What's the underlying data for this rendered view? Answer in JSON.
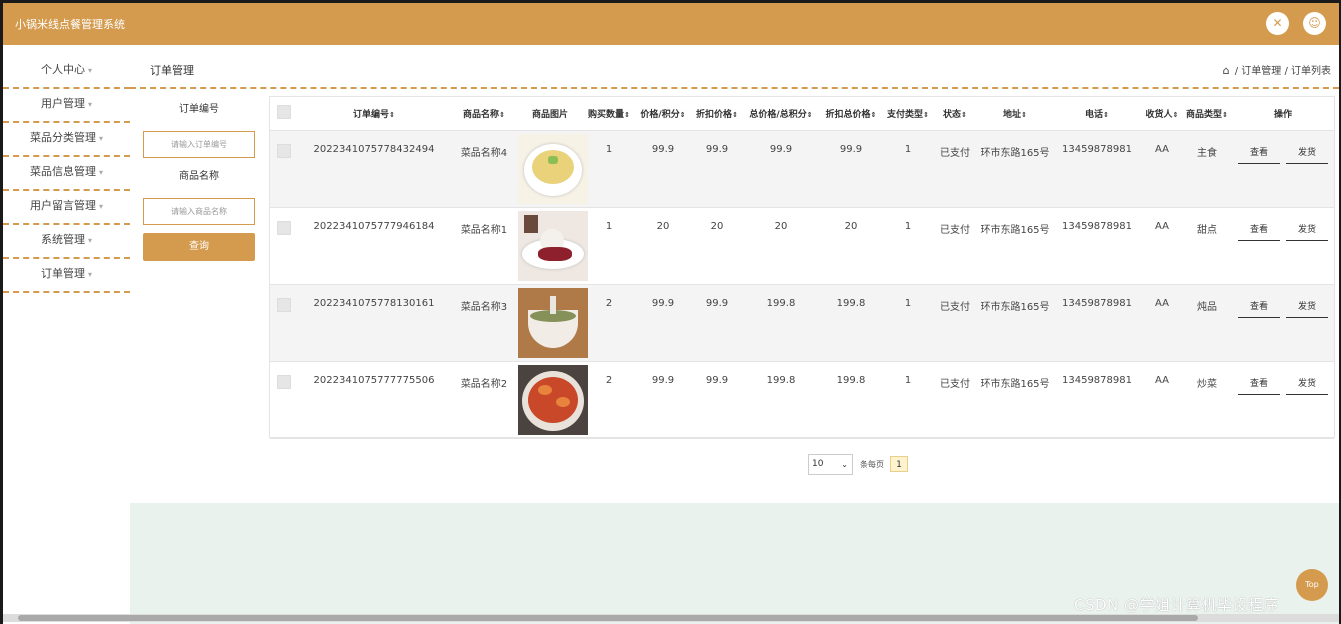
{
  "app": {
    "title": "小锅米线点餐管理系统"
  },
  "header": {
    "fullscreen_icon": "fullscreen-icon",
    "user_icon": "user-icon"
  },
  "sidebar": {
    "items": [
      {
        "label": "个人中心"
      },
      {
        "label": "用户管理"
      },
      {
        "label": "菜品分类管理"
      },
      {
        "label": "菜品信息管理"
      },
      {
        "label": "用户留言管理"
      },
      {
        "label": "系统管理"
      },
      {
        "label": "订单管理"
      }
    ],
    "caret": "▾"
  },
  "page": {
    "title": "订单管理",
    "breadcrumb": {
      "home_icon": "⌂",
      "text": " / 订单管理 / 订单列表"
    }
  },
  "search": {
    "order_no_label": "订单编号",
    "order_no_placeholder": "请输入订单编号",
    "product_name_label": "商品名称",
    "product_name_placeholder": "请输入商品名称",
    "query_button": "查询"
  },
  "table": {
    "columns": [
      "订单编号",
      "商品名称",
      "商品图片",
      "购买数量",
      "价格/积分",
      "折扣价格",
      "总价格/总积分",
      "折扣总价格",
      "支付类型",
      "状态",
      "地址",
      "电话",
      "收货人",
      "商品类型",
      "操作"
    ],
    "sort_glyph": "⇕",
    "rows": [
      {
        "order_no": "2022341075778432494",
        "name": "菜品名称4",
        "qty": "1",
        "price": "99.9",
        "discount": "99.9",
        "total": "99.9",
        "discount_total": "99.9",
        "pay_type": "1",
        "status": "已支付",
        "address": "环市东路165号",
        "phone": "13459878981",
        "receiver": "AA",
        "type": "主食"
      },
      {
        "order_no": "2022341075777946184",
        "name": "菜品名称1",
        "qty": "1",
        "price": "20",
        "discount": "20",
        "total": "20",
        "discount_total": "20",
        "pay_type": "1",
        "status": "已支付",
        "address": "环市东路165号",
        "phone": "13459878981",
        "receiver": "AA",
        "type": "甜点"
      },
      {
        "order_no": "2022341075778130161",
        "name": "菜品名称3",
        "qty": "2",
        "price": "99.9",
        "discount": "99.9",
        "total": "199.8",
        "discount_total": "199.8",
        "pay_type": "1",
        "status": "已支付",
        "address": "环市东路165号",
        "phone": "13459878981",
        "receiver": "AA",
        "type": "炖品"
      },
      {
        "order_no": "2022341075777775506",
        "name": "菜品名称2",
        "qty": "2",
        "price": "99.9",
        "discount": "99.9",
        "total": "199.8",
        "discount_total": "199.8",
        "pay_type": "1",
        "status": "已支付",
        "address": "环市东路165号",
        "phone": "13459878981",
        "receiver": "AA",
        "type": "炒菜"
      }
    ],
    "view_button": "查看",
    "ship_button": "发货"
  },
  "pagination": {
    "page_size": "10",
    "per_page_label": "条每页",
    "current_page": "1"
  },
  "top_button": "Top",
  "watermark": "CSDN @学姐计算机毕设程序"
}
